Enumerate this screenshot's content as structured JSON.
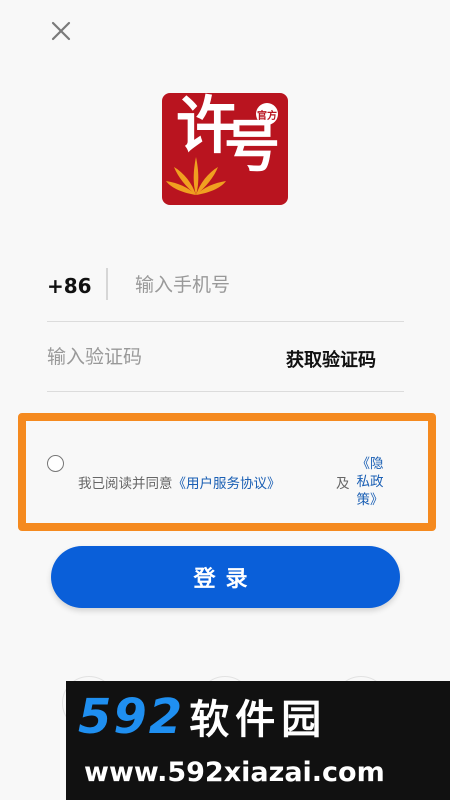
{
  "header": {
    "close_icon": "close-icon"
  },
  "logo": {
    "char1": "许",
    "char2": "号",
    "seal": "官方",
    "colors": {
      "background": "#b9141f",
      "flower": "#f0a020"
    }
  },
  "phone": {
    "country_code": "+86",
    "placeholder": "输入手机号"
  },
  "code": {
    "placeholder": "输入验证码",
    "get_code_label": "获取验证码"
  },
  "agreement": {
    "prefix": "我已阅读并同意",
    "service_link": "《用户服务协议》",
    "and": "及",
    "privacy_line1": "《隐",
    "privacy_line2": "私政",
    "privacy_line3": "策》"
  },
  "login": {
    "label": "登录"
  },
  "watermark": {
    "number": "592",
    "name": "软件园",
    "url": "www.592xiazai.com"
  },
  "colors": {
    "accent": "#0a5fd9",
    "highlight": "#f58a1f",
    "link": "#1a5fb4"
  }
}
